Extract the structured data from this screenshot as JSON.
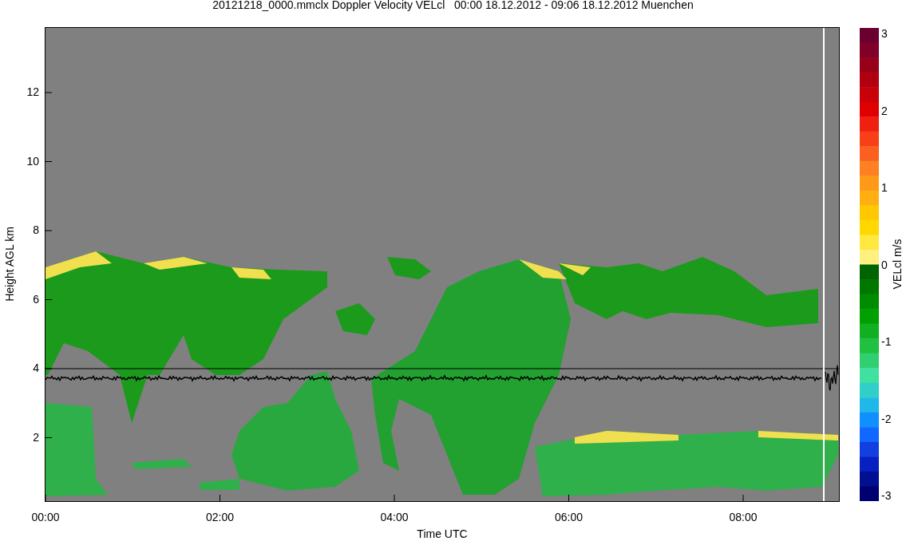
{
  "title": "20121218_0000.mmclx Doppler Velocity VELcl   00:00 18.12.2012 - 09:06 18.12.2012 Muenchen",
  "y_axis": {
    "label": "Height AGL km",
    "ticks": [
      "12",
      "10",
      "8",
      "6",
      "4",
      "2"
    ]
  },
  "x_axis": {
    "label": "Time UTC",
    "ticks": [
      "00:00",
      "02:00",
      "04:00",
      "06:00",
      "08:00"
    ]
  },
  "colorbar": {
    "label": "VELcl m/s",
    "ticks": [
      "3",
      "2",
      "1",
      "0",
      "-1",
      "-2",
      "-3"
    ]
  }
}
